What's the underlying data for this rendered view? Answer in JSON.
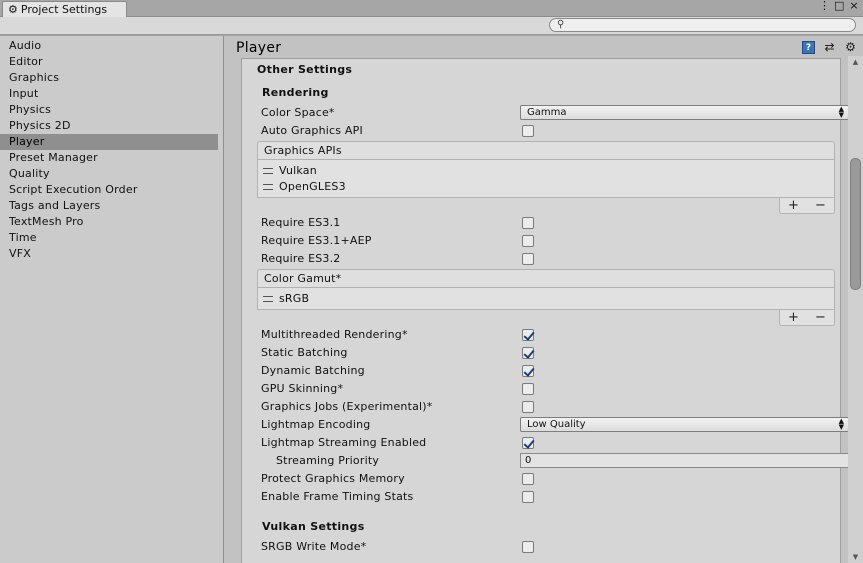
{
  "window": {
    "tab_title": "Project Settings",
    "buttons": [
      "⋮",
      "□",
      "×"
    ]
  },
  "search": {
    "placeholder": ""
  },
  "sidebar": {
    "items": [
      {
        "label": "Audio"
      },
      {
        "label": "Editor"
      },
      {
        "label": "Graphics"
      },
      {
        "label": "Input"
      },
      {
        "label": "Physics"
      },
      {
        "label": "Physics 2D"
      },
      {
        "label": "Player",
        "selected": true
      },
      {
        "label": "Preset Manager"
      },
      {
        "label": "Quality"
      },
      {
        "label": "Script Execution Order"
      },
      {
        "label": "Tags and Layers"
      },
      {
        "label": "TextMesh Pro"
      },
      {
        "label": "Time"
      },
      {
        "label": "VFX"
      }
    ]
  },
  "main": {
    "title": "Player",
    "header_icons": [
      "help-icon",
      "preset-icon",
      "gear-icon"
    ],
    "section": "Other Settings",
    "rendering": {
      "heading": "Rendering",
      "color_space": {
        "label": "Color Space*",
        "value": "Gamma"
      },
      "auto_graphics_api": {
        "label": "Auto Graphics API",
        "checked": false
      },
      "graphics_apis": {
        "header": "Graphics APIs",
        "items": [
          "Vulkan",
          "OpenGLES3"
        ]
      },
      "require_es31": {
        "label": "Require ES3.1",
        "checked": false
      },
      "require_es31_aep": {
        "label": "Require ES3.1+AEP",
        "checked": false
      },
      "require_es32": {
        "label": "Require ES3.2",
        "checked": false
      },
      "color_gamut": {
        "header": "Color Gamut*",
        "items": [
          "sRGB"
        ]
      },
      "multithreaded": {
        "label": "Multithreaded Rendering*",
        "checked": true
      },
      "static_batching": {
        "label": "Static Batching",
        "checked": true
      },
      "dynamic_batching": {
        "label": "Dynamic Batching",
        "checked": true
      },
      "gpu_skinning": {
        "label": "GPU Skinning*",
        "checked": false
      },
      "graphics_jobs": {
        "label": "Graphics Jobs (Experimental)*",
        "checked": false
      },
      "lightmap_encoding": {
        "label": "Lightmap Encoding",
        "value": "Low Quality"
      },
      "lightmap_streaming": {
        "label": "Lightmap Streaming Enabled",
        "checked": true
      },
      "streaming_priority": {
        "label": "Streaming Priority",
        "value": "0"
      },
      "protect_memory": {
        "label": "Protect Graphics Memory",
        "checked": false
      },
      "frame_timing": {
        "label": "Enable Frame Timing Stats",
        "checked": false
      }
    },
    "vulkan": {
      "heading": "Vulkan Settings",
      "srgb_write_mode": {
        "label": "SRGB Write Mode*",
        "checked": false
      }
    },
    "list_buttons": {
      "add": "+",
      "remove": "−"
    }
  }
}
